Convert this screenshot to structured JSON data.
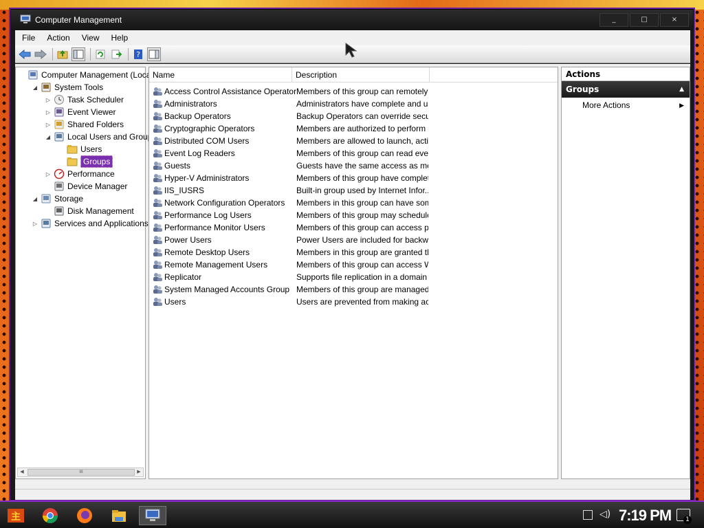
{
  "window": {
    "title": "Computer Management",
    "controls": {
      "minimize": "_",
      "maximize": "□",
      "close": "×"
    }
  },
  "menu": [
    "File",
    "Action",
    "View",
    "Help"
  ],
  "toolbar": {
    "buttons": [
      "back-arrow-icon",
      "forward-arrow-icon",
      "up-folder-icon",
      "show-hide-tree-icon",
      "refresh-icon",
      "export-list-icon",
      "help-icon",
      "show-hide-action-pane-icon"
    ]
  },
  "tree": {
    "items": [
      {
        "label": "Computer Management (Local)",
        "depth": 0,
        "arrow": "",
        "icon": "computer-management-icon",
        "selected": false
      },
      {
        "label": "System Tools",
        "depth": 1,
        "arrow": "◢",
        "icon": "system-tools-icon",
        "selected": false
      },
      {
        "label": "Task Scheduler",
        "depth": 2,
        "arrow": "▷",
        "icon": "task-scheduler-icon",
        "selected": false
      },
      {
        "label": "Event Viewer",
        "depth": 2,
        "arrow": "▷",
        "icon": "event-viewer-icon",
        "selected": false
      },
      {
        "label": "Shared Folders",
        "depth": 2,
        "arrow": "▷",
        "icon": "shared-folders-icon",
        "selected": false
      },
      {
        "label": "Local Users and Groups",
        "depth": 2,
        "arrow": "◢",
        "icon": "local-users-groups-icon",
        "selected": false
      },
      {
        "label": "Users",
        "depth": 3,
        "arrow": "",
        "icon": "folder-icon",
        "selected": false
      },
      {
        "label": "Groups",
        "depth": 3,
        "arrow": "",
        "icon": "folder-icon",
        "selected": true
      },
      {
        "label": "Performance",
        "depth": 2,
        "arrow": "▷",
        "icon": "performance-icon",
        "selected": false
      },
      {
        "label": "Device Manager",
        "depth": 2,
        "arrow": "",
        "icon": "device-manager-icon",
        "selected": false
      },
      {
        "label": "Storage",
        "depth": 1,
        "arrow": "◢",
        "icon": "storage-icon",
        "selected": false
      },
      {
        "label": "Disk Management",
        "depth": 2,
        "arrow": "",
        "icon": "disk-management-icon",
        "selected": false
      },
      {
        "label": "Services and Applications",
        "depth": 1,
        "arrow": "▷",
        "icon": "services-applications-icon",
        "selected": false
      }
    ],
    "scroll_thumb_glyph": "III"
  },
  "list": {
    "columns": [
      "Name",
      "Description"
    ],
    "rows": [
      {
        "name": "Access Control Assistance Operators",
        "description": "Members of this group can remotely ..."
      },
      {
        "name": "Administrators",
        "description": "Administrators have complete and un..."
      },
      {
        "name": "Backup Operators",
        "description": "Backup Operators can override secu..."
      },
      {
        "name": "Cryptographic Operators",
        "description": "Members are authorized to perform c..."
      },
      {
        "name": "Distributed COM Users",
        "description": "Members are allowed to launch, activ..."
      },
      {
        "name": "Event Log Readers",
        "description": "Members of this group can read eve..."
      },
      {
        "name": "Guests",
        "description": "Guests have the same access as me..."
      },
      {
        "name": "Hyper-V Administrators",
        "description": "Members of this group have complet..."
      },
      {
        "name": "IIS_IUSRS",
        "description": "Built-in group used by Internet Infor..."
      },
      {
        "name": "Network Configuration Operators",
        "description": "Members in this group can have som..."
      },
      {
        "name": "Performance Log Users",
        "description": "Members of this group may schedule ..."
      },
      {
        "name": "Performance Monitor Users",
        "description": "Members of this group can access pe..."
      },
      {
        "name": "Power Users",
        "description": "Power Users are included for backw..."
      },
      {
        "name": "Remote Desktop Users",
        "description": "Members in this group are granted th..."
      },
      {
        "name": "Remote Management Users",
        "description": "Members of this group can access W..."
      },
      {
        "name": "Replicator",
        "description": "Supports file replication in a domain"
      },
      {
        "name": "System Managed Accounts Group",
        "description": "Members of this group are managed ..."
      },
      {
        "name": "Users",
        "description": "Users are prevented from making ac..."
      }
    ]
  },
  "actions": {
    "title": "Actions",
    "section": "Groups",
    "items": [
      "More Actions"
    ]
  },
  "taskbar": {
    "apps": [
      "start-icon",
      "chrome-icon",
      "firefox-icon",
      "file-explorer-icon",
      "computer-management-taskbar-icon"
    ],
    "clock": "7:19 PM",
    "notification_count": "1"
  },
  "colors": {
    "selection": "#7a2fb0",
    "accent_border": "#8a2cc0",
    "titlebar": "#1a1a1a"
  }
}
